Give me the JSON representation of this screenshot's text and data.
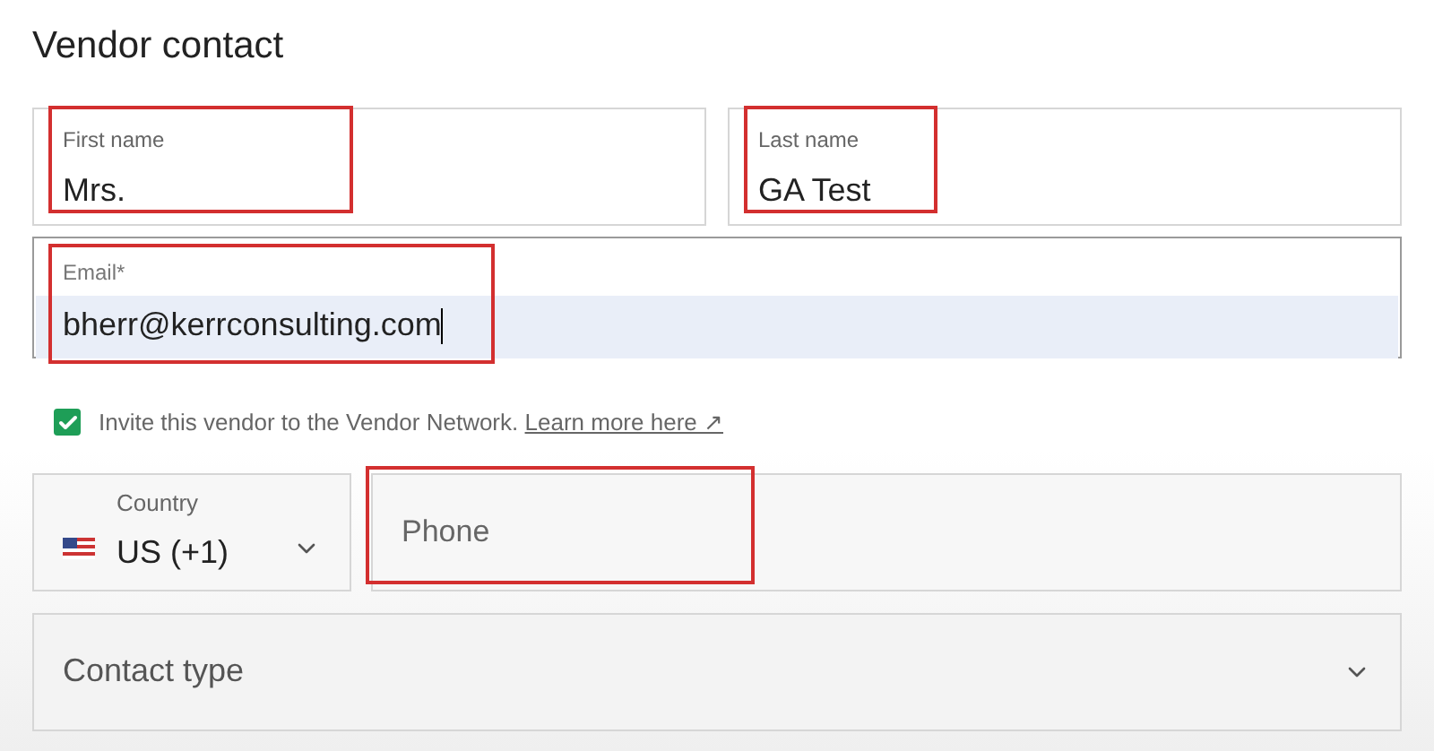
{
  "title": "Vendor contact",
  "name_fields": [
    {
      "label": "First name",
      "value": "Mrs.",
      "highlighted": true
    },
    {
      "label": "Last name",
      "value": "GA Test",
      "highlighted": true
    }
  ],
  "email": {
    "label": "Email*",
    "value": "bherr@kerrconsulting.com",
    "highlighted": true
  },
  "invite": {
    "checked": true,
    "text": "Invite this vendor to the Vendor Network.",
    "link": "Learn more here ↗"
  },
  "country": {
    "label": "Country",
    "value": "US (+1)"
  },
  "phone": {
    "placeholder": "Phone",
    "highlighted": true
  },
  "contact_type": {
    "placeholder": "Contact type"
  }
}
